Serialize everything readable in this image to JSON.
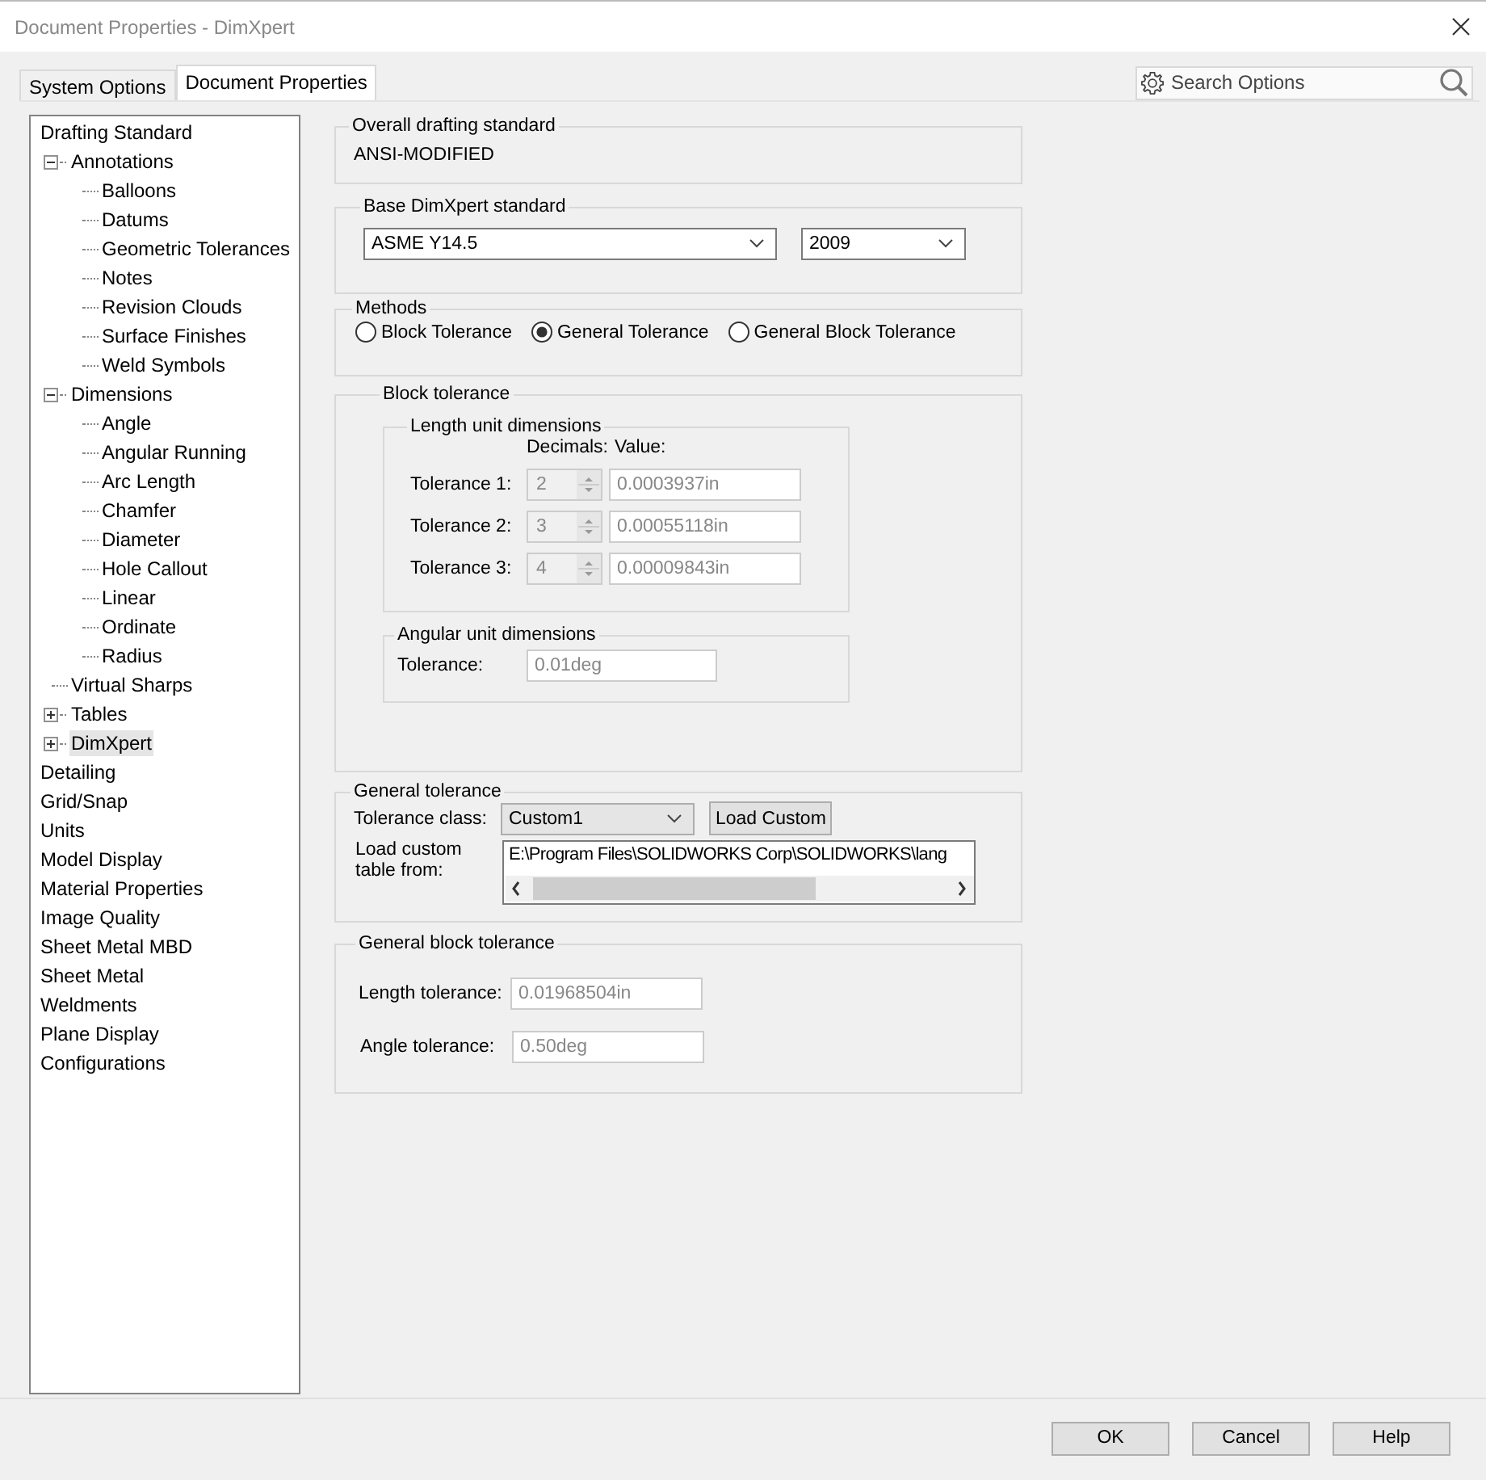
{
  "window": {
    "title": "Document Properties - DimXpert"
  },
  "tabs": [
    {
      "label": "System Options",
      "selected": false
    },
    {
      "label": "Document Properties",
      "selected": true
    }
  ],
  "search": {
    "placeholder": "Search Options"
  },
  "tree": {
    "items": [
      {
        "label": "Drafting Standard",
        "selected": false,
        "children": [
          {
            "label": "Annotations",
            "selected": false,
            "expanded": true,
            "children": [
              {
                "label": "Balloons",
                "selected": false
              },
              {
                "label": "Datums",
                "selected": false
              },
              {
                "label": "Geometric Tolerances",
                "selected": false
              },
              {
                "label": "Notes",
                "selected": false
              },
              {
                "label": "Revision Clouds",
                "selected": false
              },
              {
                "label": "Surface Finishes",
                "selected": false
              },
              {
                "label": "Weld Symbols",
                "selected": false
              }
            ]
          },
          {
            "label": "Dimensions",
            "selected": false,
            "expanded": true,
            "children": [
              {
                "label": "Angle",
                "selected": false
              },
              {
                "label": "Angular Running",
                "selected": false
              },
              {
                "label": "Arc Length",
                "selected": false
              },
              {
                "label": "Chamfer",
                "selected": false
              },
              {
                "label": "Diameter",
                "selected": false
              },
              {
                "label": "Hole Callout",
                "selected": false
              },
              {
                "label": "Linear",
                "selected": false
              },
              {
                "label": "Ordinate",
                "selected": false
              },
              {
                "label": "Radius",
                "selected": false
              }
            ]
          },
          {
            "label": "Virtual Sharps",
            "selected": false
          },
          {
            "label": "Tables",
            "selected": false,
            "expanded": false
          },
          {
            "label": "DimXpert",
            "selected": true,
            "expanded": false
          }
        ]
      },
      {
        "label": "Detailing",
        "selected": false
      },
      {
        "label": "Grid/Snap",
        "selected": false
      },
      {
        "label": "Units",
        "selected": false
      },
      {
        "label": "Model Display",
        "selected": false
      },
      {
        "label": "Material Properties",
        "selected": false
      },
      {
        "label": "Image Quality",
        "selected": false
      },
      {
        "label": "Sheet Metal MBD",
        "selected": false
      },
      {
        "label": "Sheet Metal",
        "selected": false
      },
      {
        "label": "Weldments",
        "selected": false
      },
      {
        "label": "Plane Display",
        "selected": false
      },
      {
        "label": "Configurations",
        "selected": false
      }
    ]
  },
  "overall_drafting_standard": {
    "title": "Overall drafting standard",
    "value": "ANSI-MODIFIED"
  },
  "base_dimxpert_standard": {
    "title": "Base DimXpert standard",
    "standard": "ASME Y14.5",
    "year": "2009"
  },
  "methods": {
    "title": "Methods",
    "options": [
      {
        "label": "Block Tolerance",
        "selected": false
      },
      {
        "label": "General Tolerance",
        "selected": true
      },
      {
        "label": "General Block Tolerance",
        "selected": false
      }
    ]
  },
  "block_tolerance": {
    "title": "Block tolerance",
    "length_unit_dimensions": {
      "title": "Length unit dimensions",
      "headers": [
        "Decimals:",
        "Value:"
      ],
      "rows": [
        {
          "label": "Tolerance 1:",
          "decimals": "2",
          "value": "0.0003937in",
          "disabled": true
        },
        {
          "label": "Tolerance 2:",
          "decimals": "3",
          "value": "0.00055118in",
          "disabled": true
        },
        {
          "label": "Tolerance 3:",
          "decimals": "4",
          "value": "0.00009843in",
          "disabled": true
        }
      ]
    },
    "angular_unit_dimensions": {
      "title": "Angular unit dimensions",
      "label": "Tolerance:",
      "value": "0.01deg",
      "disabled": true
    }
  },
  "general_tolerance": {
    "title": "General tolerance",
    "class_label": "Tolerance class:",
    "class_value": "Custom1",
    "load_button": "Load Custom",
    "path_label": "Load custom table from:",
    "path_value": "E:\\Program Files\\SOLIDWORKS Corp\\SOLIDWORKS\\lang"
  },
  "general_block_tolerance": {
    "title": "General block tolerance",
    "rows": [
      {
        "label": "Length tolerance:",
        "value": "0.01968504in",
        "disabled": true
      },
      {
        "label": "Angle tolerance:",
        "value": "0.50deg",
        "disabled": true
      }
    ]
  },
  "buttons": [
    "OK",
    "Cancel",
    "Help"
  ]
}
